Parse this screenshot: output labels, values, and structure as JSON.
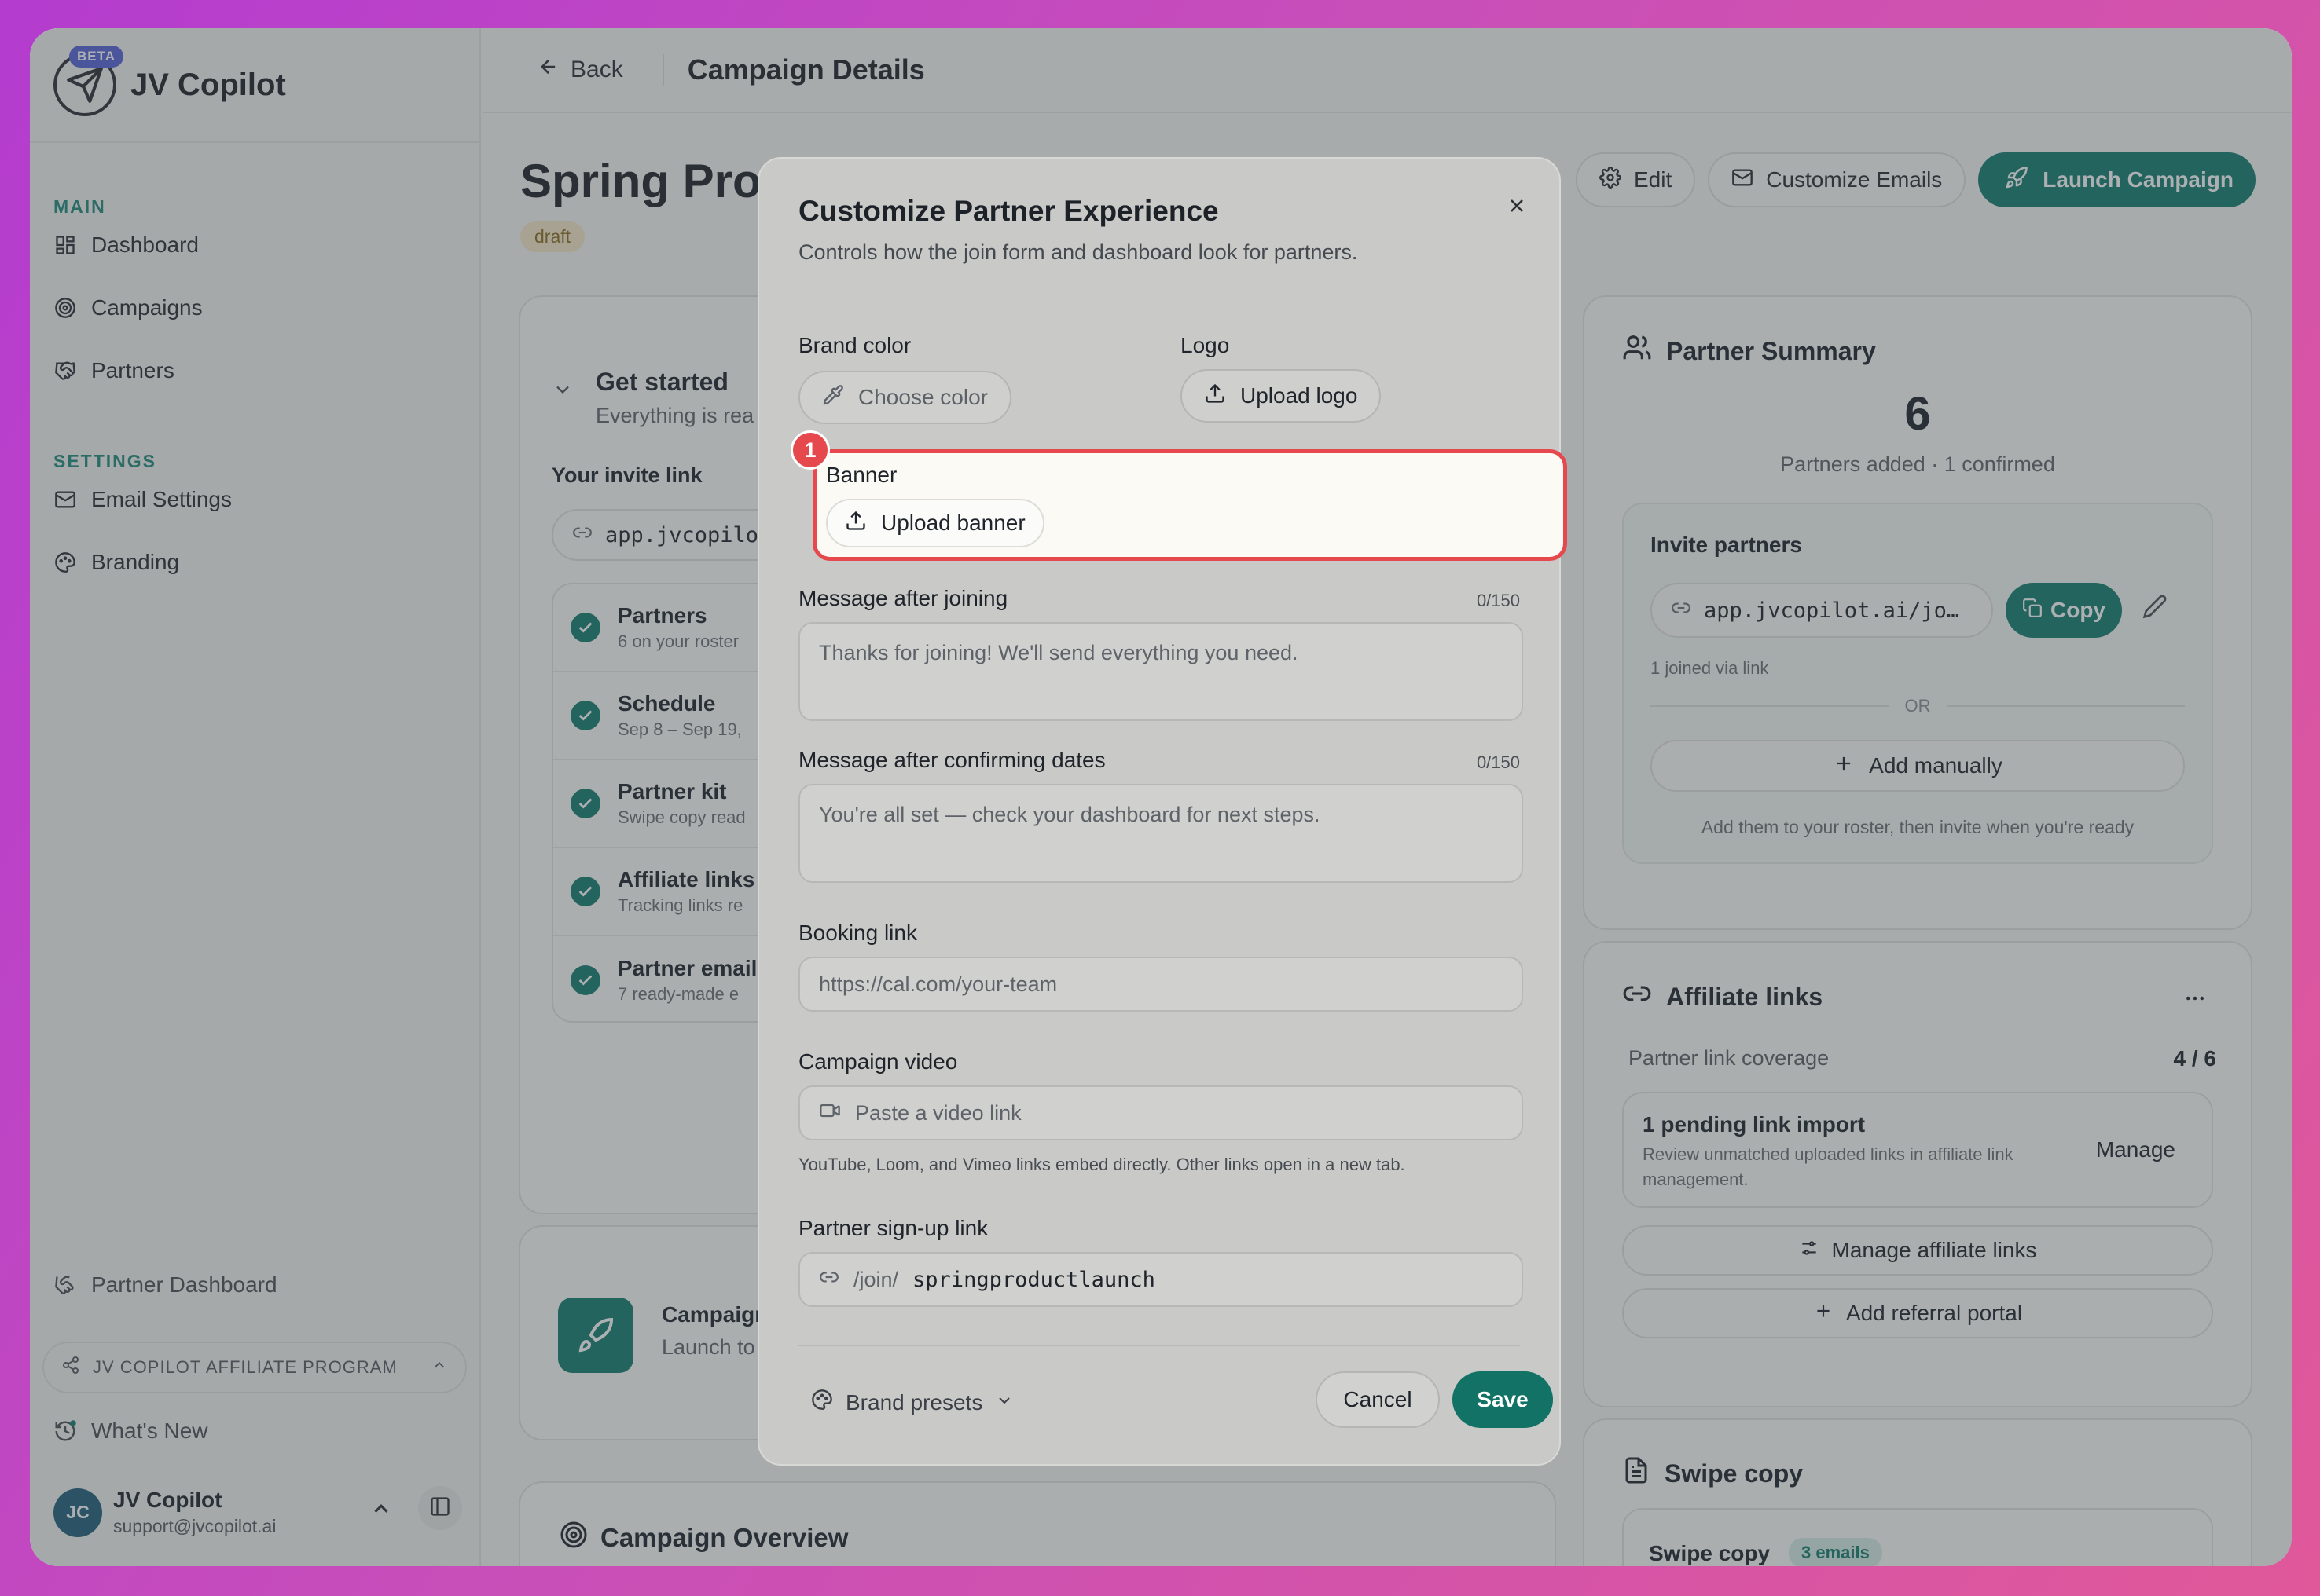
{
  "app": {
    "name": "JV Copilot",
    "beta_badge": "BETA"
  },
  "sidebar": {
    "main_heading": "MAIN",
    "main_items": [
      {
        "label": "Dashboard",
        "icon": "dashboard-icon"
      },
      {
        "label": "Campaigns",
        "icon": "target-icon"
      },
      {
        "label": "Partners",
        "icon": "handshake-icon"
      }
    ],
    "settings_heading": "SETTINGS",
    "settings_items": [
      {
        "label": "Email Settings",
        "icon": "mail-icon"
      },
      {
        "label": "Branding",
        "icon": "palette-icon"
      }
    ],
    "partner_dashboard": "Partner Dashboard",
    "program": "JV COPILOT AFFILIATE PROGRAM",
    "whats_new": "What's New",
    "user": {
      "initials": "JC",
      "name": "JV Copilot",
      "email": "support@jvcopilot.ai"
    }
  },
  "topbar": {
    "back_label": "Back",
    "title": "Campaign Details"
  },
  "page": {
    "title": "Spring Pro",
    "status_badge": "draft",
    "actions": {
      "edit": "Edit",
      "customize_emails": "Customize Emails",
      "launch": "Launch Campaign"
    }
  },
  "get_started": {
    "title": "Get started",
    "subtitle": "Everything is rea",
    "invite_label": "Your invite link",
    "invite_value": "app.jvcopilo",
    "steps": [
      {
        "title": "Partners",
        "sub": "6 on your roster"
      },
      {
        "title": "Schedule",
        "sub": "Sep 8 – Sep 19,"
      },
      {
        "title": "Partner kit",
        "sub": "Swipe copy read"
      },
      {
        "title": "Affiliate links",
        "sub": "Tracking links re"
      },
      {
        "title": "Partner email",
        "sub": "7 ready-made e"
      }
    ]
  },
  "campaign_card": {
    "title": "Campaign",
    "sub": "Launch to"
  },
  "overview": {
    "title": "Campaign Overview"
  },
  "partner_summary": {
    "title": "Partner Summary",
    "count": "6",
    "sub": "Partners added · 1 confirmed",
    "invite_label": "Invite partners",
    "invite_link": "app.jvcopilot.ai/jo…",
    "copy": "Copy",
    "joined": "1 joined via link",
    "or": "OR",
    "add_manually": "Add manually",
    "hint": "Add them to your roster, then invite when you're ready"
  },
  "affiliate": {
    "title": "Affiliate links",
    "coverage_label": "Partner link coverage",
    "coverage_value": "4 / 6",
    "pending_title": "1 pending link import",
    "pending_sub": "Review unmatched uploaded links in affiliate link management.",
    "manage": "Manage",
    "manage_links": "Manage affiliate links",
    "add_portal": "Add referral portal"
  },
  "swipe": {
    "title": "Swipe copy",
    "row_label": "Swipe copy",
    "badge": "3 emails"
  },
  "modal": {
    "title": "Customize Partner Experience",
    "subtitle": "Controls how the join form and dashboard look for partners.",
    "brand_color_label": "Brand color",
    "brand_color_button": "Choose color",
    "logo_label": "Logo",
    "logo_button": "Upload logo",
    "banner_label": "Banner",
    "banner_button": "Upload banner",
    "msg_join_label": "Message after joining",
    "msg_join_count": "0/150",
    "msg_join_placeholder": "Thanks for joining! We'll send everything you need.",
    "msg_confirm_label": "Message after confirming dates",
    "msg_confirm_count": "0/150",
    "msg_confirm_placeholder": "You're all set — check your dashboard for next steps.",
    "booking_label": "Booking link",
    "booking_placeholder": "https://cal.com/your-team",
    "video_label": "Campaign video",
    "video_placeholder": "Paste a video link",
    "video_helper": "YouTube, Loom, and Vimeo links embed directly. Other links open in a new tab.",
    "signup_label": "Partner sign-up link",
    "signup_prefix": "/join/",
    "signup_slug": "springproductlaunch",
    "presets": "Brand presets",
    "cancel": "Cancel",
    "save": "Save"
  },
  "annotation": {
    "marker": "1",
    "color": "#e5484d"
  },
  "colors": {
    "accent": "#137d6e",
    "highlight": "#e5484d"
  }
}
